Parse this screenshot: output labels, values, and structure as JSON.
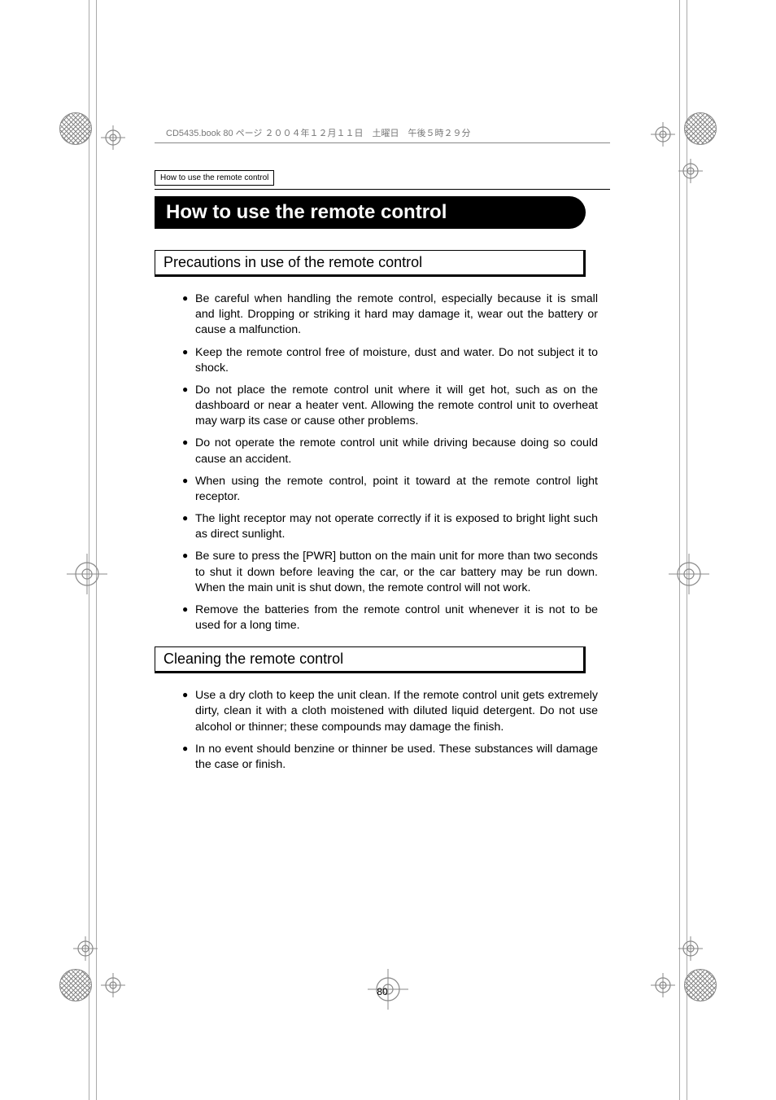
{
  "meta_header": "CD5435.book  80 ページ  ２００４年１２月１１日　土曜日　午後５時２９分",
  "breadcrumb": "How to use the remote control",
  "title": "How to use the remote control",
  "sections": [
    {
      "heading": "Precautions in use of the remote control",
      "bullets": [
        "Be careful when handling the remote control, especially because it is small and light. Dropping or striking it hard may damage it, wear out the battery or cause a malfunction.",
        "Keep the remote control free of moisture, dust and water. Do not subject it to shock.",
        "Do not place the remote control unit where it will get hot, such as on the dashboard or near a heater vent.  Allowing the remote control unit to overheat may warp its case or cause other problems.",
        "Do not operate the remote control unit while driving because doing so could cause an accident.",
        "When using the remote control, point it toward at the remote control light receptor.",
        "The light receptor may not operate correctly if it is exposed to bright light such as direct sunlight.",
        "Be sure to press the [PWR] button on the main unit for more than two seconds to shut it down before leaving the car, or the car battery may be run down. When the main unit is shut down, the remote control will not work.",
        "Remove the batteries from the remote control unit whenever it is not to be used for a long time."
      ]
    },
    {
      "heading": "Cleaning the remote control",
      "bullets": [
        "Use a dry cloth to keep the unit clean.  If the remote control unit gets extremely dirty, clean it with a cloth moistened with diluted liquid detergent.  Do not use alcohol or thinner; these compounds may damage the finish.",
        "In no event should benzine or thinner be used. These substances will damage the case or finish."
      ]
    }
  ],
  "page_number": "80"
}
